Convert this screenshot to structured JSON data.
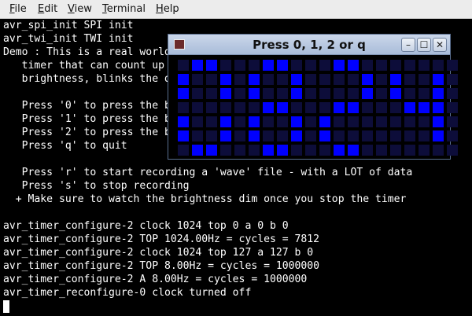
{
  "menu": [
    {
      "label": "File",
      "u": "F",
      "rest": "ile"
    },
    {
      "label": "Edit",
      "u": "E",
      "rest": "dit"
    },
    {
      "label": "View",
      "u": "V",
      "rest": "iew"
    },
    {
      "label": "Terminal",
      "u": "T",
      "rest": "erminal"
    },
    {
      "label": "Help",
      "u": "H",
      "rest": "elp"
    }
  ],
  "terminal_lines": [
    "avr_spi_init SPI init",
    "avr_twi_init TWI init",
    "Demo : This is a real world firmware, a 'stopwatch'",
    "   timer that can count up to 99 seconds. It changes the",
    "   brightness, blinks the digits, and also has a demo to o",
    "",
    "   Press '0' to press the button 'start/stop'",
    "   Press '1' to press the button 'reset'",
    "   Press '2' to press the button 'brightness'",
    "   Press 'q' to quit",
    "",
    "   Press 'r' to start recording a 'wave' file - with a LOT of data",
    "   Press 's' to stop recording",
    "  + Make sure to watch the brightness dim once you stop the timer",
    "",
    "avr_timer_configure-2 clock 1024 top 0 a 0 b 0",
    "avr_timer_configure-2 TOP 1024.00Hz = cycles = 7812",
    "avr_timer_configure-2 clock 1024 top 127 a 127 b 0",
    "avr_timer_configure-2 TOP 8.00Hz = cycles = 1000000",
    "avr_timer_configure-2 A 8.00Hz = cycles = 1000000",
    "avr_timer_reconfigure-0 clock turned off"
  ],
  "popup": {
    "title": "Press 0, 1, 2 or q",
    "minimize_glyph": "–",
    "maximize_glyph": "☐",
    "close_glyph": "✕"
  },
  "display": {
    "on_color": "#0000ff",
    "off_color": "#0d0d3a",
    "digits": [
      [
        "01100",
        "10010",
        "10010",
        "00000",
        "10010",
        "10010",
        "01100"
      ],
      [
        "01100",
        "10010",
        "10010",
        "01100",
        "10010",
        "10010",
        "01100"
      ],
      [
        "01100",
        "00010",
        "00010",
        "01100",
        "10000",
        "10000",
        "01100"
      ],
      [
        "00000",
        "10010",
        "10010",
        "01110",
        "00010",
        "00010",
        "00000"
      ]
    ]
  }
}
